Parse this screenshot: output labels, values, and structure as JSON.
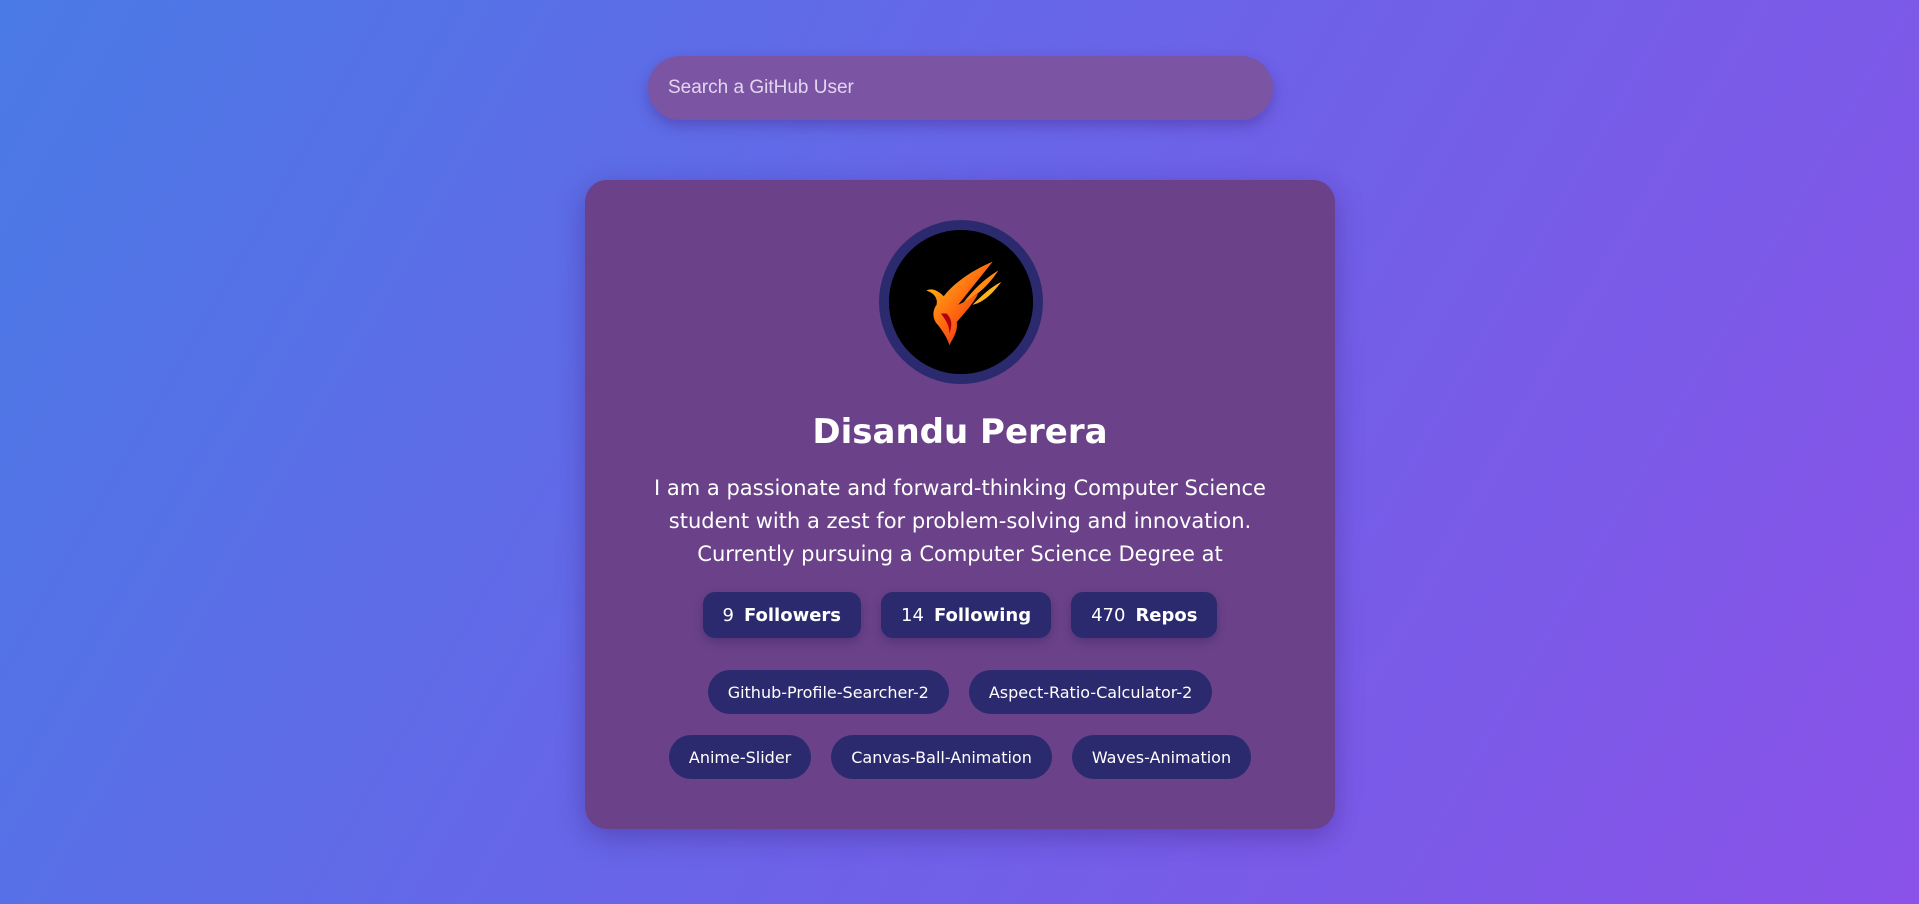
{
  "search": {
    "placeholder": "Search a GitHub User",
    "value": ""
  },
  "profile": {
    "name": "Disandu Perera",
    "bio": "I am a passionate and forward-thinking Computer Science student with a zest for problem-solving and innovation. Currently pursuing a Computer Science Degree at",
    "avatar_icon": "phoenix-logo-icon",
    "stats": [
      {
        "count": "9",
        "label": "Followers"
      },
      {
        "count": "14",
        "label": "Following"
      },
      {
        "count": "470",
        "label": "Repos"
      }
    ],
    "repos": [
      "Github-Profile-Searcher-2",
      "Aspect-Ratio-Calculator-2",
      "Anime-Slider",
      "Canvas-Ball-Animation",
      "Waves-Animation"
    ]
  },
  "colors": {
    "background_start": "#4a7ae6",
    "background_end": "#8a52e8",
    "card": "#6b4289",
    "search": "#7c54a4",
    "pill": "#2c2a6e"
  }
}
